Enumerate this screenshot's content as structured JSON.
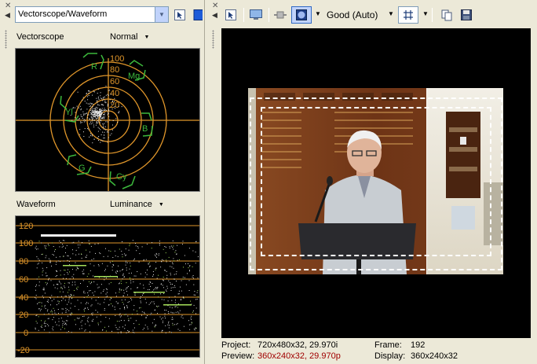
{
  "scopes": {
    "title": "Vectorscope/Waveform",
    "vectorscope": {
      "label": "Vectorscope",
      "mode": "Normal",
      "ring_labels": [
        "100",
        "80",
        "60",
        "40",
        "20"
      ],
      "targets": [
        "R",
        "Mg",
        "B",
        "Cy",
        "G",
        "Yl"
      ]
    },
    "waveform": {
      "label": "Waveform",
      "mode": "Luminance",
      "scale": [
        "120",
        "100",
        "80",
        "60",
        "40",
        "20",
        "0",
        "-20"
      ]
    }
  },
  "preview": {
    "quality": "Good (Auto)",
    "info": {
      "project_label": "Project:",
      "project_value": "720x480x32, 29.970i",
      "preview_label": "Preview:",
      "preview_value": "360x240x32, 29.970p",
      "frame_label": "Frame:",
      "frame_value": "192",
      "display_label": "Display:",
      "display_value": "360x240x32"
    }
  },
  "colors": {
    "scope_grid": "#e0962a",
    "target_box": "#3cb83c",
    "preview_value_red": "#a00000"
  }
}
